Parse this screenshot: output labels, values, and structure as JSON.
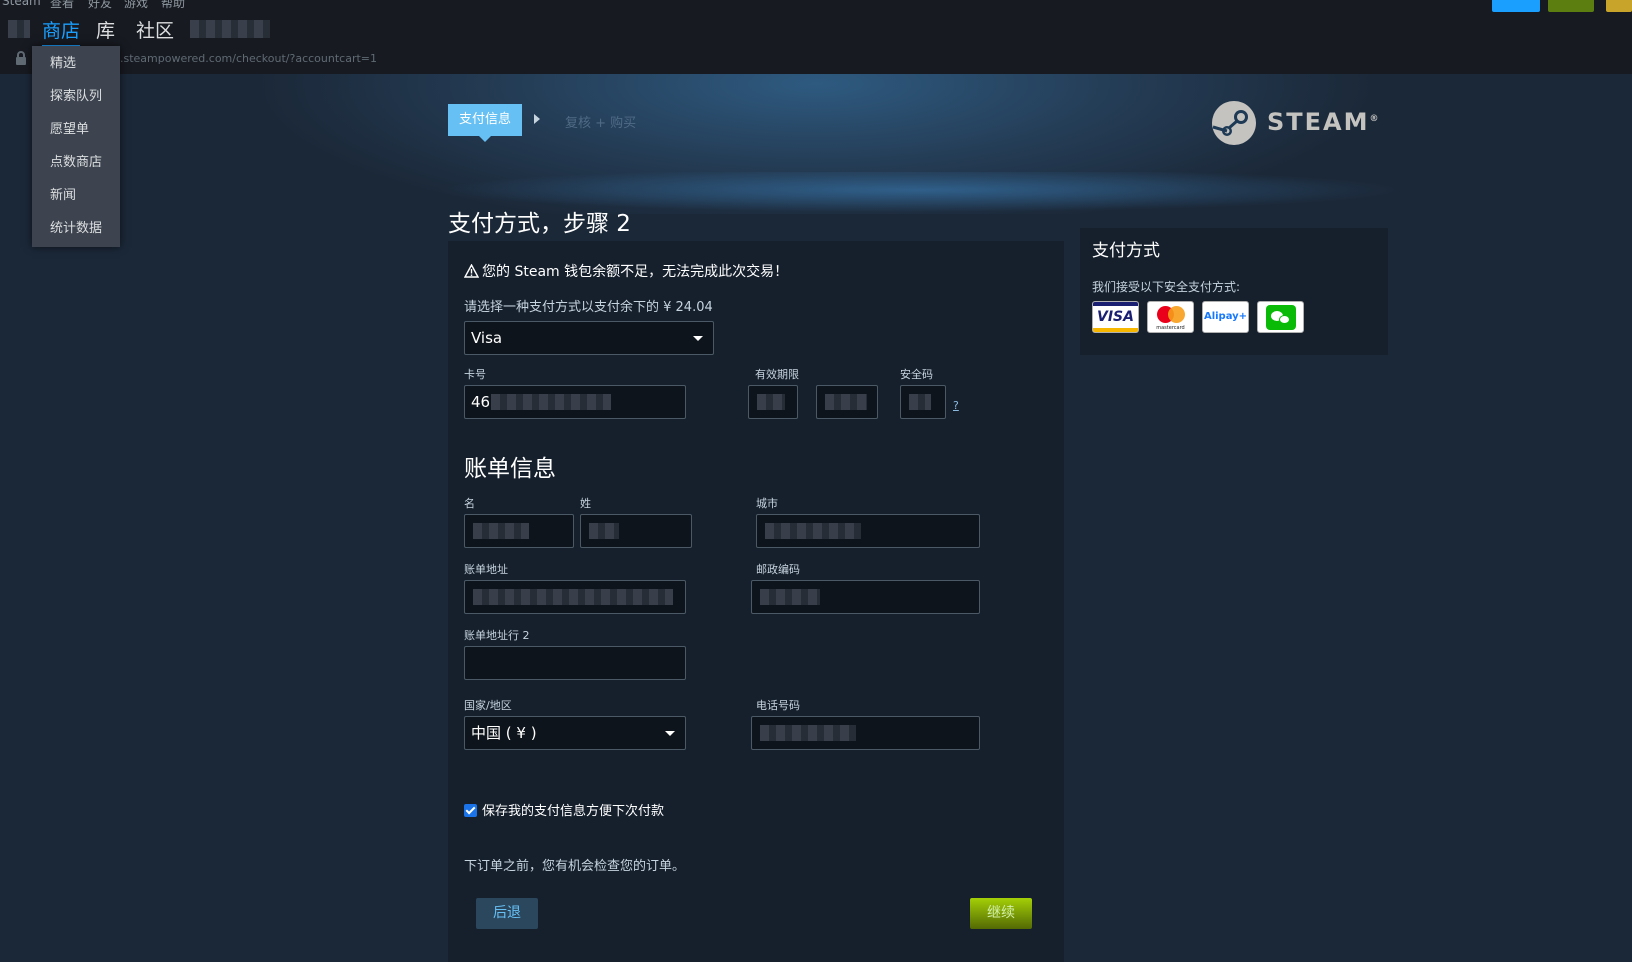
{
  "menu": {
    "items": [
      "Steam",
      "查看",
      "好友",
      "游戏",
      "帮助"
    ]
  },
  "nav": {
    "store": "商店",
    "library": "库",
    "community": "社区"
  },
  "address": {
    "url": ".steampowered.com/checkout/?accountcart=1"
  },
  "store_menu": {
    "items": [
      "精选",
      "探索队列",
      "愿望单",
      "点数商店",
      "新闻",
      "统计数据"
    ]
  },
  "steps": {
    "active": "支付信息",
    "next": "复核 + 购买"
  },
  "logo": {
    "text": "STEAM",
    "mark": "®"
  },
  "main": {
    "title": "支付方式，步骤 2",
    "warning": "您的 Steam 钱包余额不足，无法完成此次交易！",
    "prompt": "请选择一种支付方式以支付余下的 ¥ 24.04",
    "payment_method": "Visa",
    "card_number_label": "卡号",
    "card_number_value": "46",
    "expiry_label": "有效期限",
    "cvv_label": "安全码",
    "cvv_help": "?",
    "billing_heading": "账单信息",
    "first_name_label": "名",
    "last_name_label": "姓",
    "city_label": "城市",
    "address_label": "账单地址",
    "postcode_label": "邮政编码",
    "address2_label": "账单地址行 2",
    "country_label": "国家/地区",
    "country_value": "中国 ( ¥ )",
    "phone_label": "电话号码",
    "save_label": "保存我的支付信息方便下次付款",
    "review_note": "下订单之前，您有机会检查您的订单。",
    "back_label": "后退",
    "continue_label": "继续"
  },
  "sidebar": {
    "heading": "支付方式",
    "subtitle": "我们接受以下安全支付方式:",
    "methods": [
      "VISA",
      "mastercard",
      "Alipay+",
      "wechat-pay"
    ]
  },
  "colors": {
    "accent_blue": "#66c0f4",
    "page_bg": "#1b2838",
    "continue_green": "#a4d007"
  }
}
